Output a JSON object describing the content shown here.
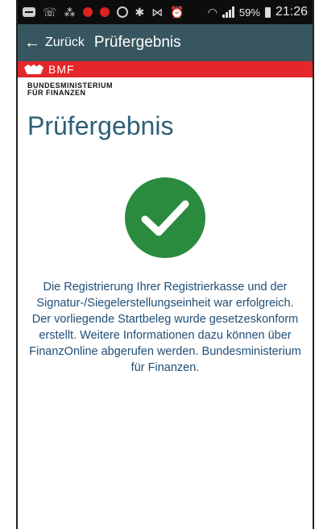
{
  "status_bar": {
    "battery_percent": "59%",
    "time": "21:26",
    "icons": [
      "message-icon",
      "wifi-call-icon",
      "nfc-icon",
      "red-record-icon",
      "red-record-icon",
      "sync-icon",
      "bluetooth-icon",
      "vibrate-icon",
      "alarm-icon",
      "wifi-icon",
      "signal-icon",
      "battery-icon"
    ]
  },
  "appbar": {
    "back_label": "Zurück",
    "title": "Prüfergebnis"
  },
  "header": {
    "brand": "BMF",
    "ministry_line1": "BUNDESMINISTERIUM",
    "ministry_line2": "FÜR FINANZEN"
  },
  "main": {
    "title": "Prüfergebnis",
    "message": "Die Registrierung Ihrer Registrierkasse und der Signatur-/Siegelerstellungseinheit war erfolgreich. Der vorliegende Startbeleg wurde gesetzeskonform erstellt. Weitere Informationen dazu können über FinanzOnline abgerufen werden. Bundesministerium für Finanzen."
  },
  "colors": {
    "appbar": "#37565f",
    "brand_red": "#e4272a",
    "title_blue": "#2f5f76",
    "success_green": "#2a8a3e",
    "message_blue": "#1f4f78"
  }
}
